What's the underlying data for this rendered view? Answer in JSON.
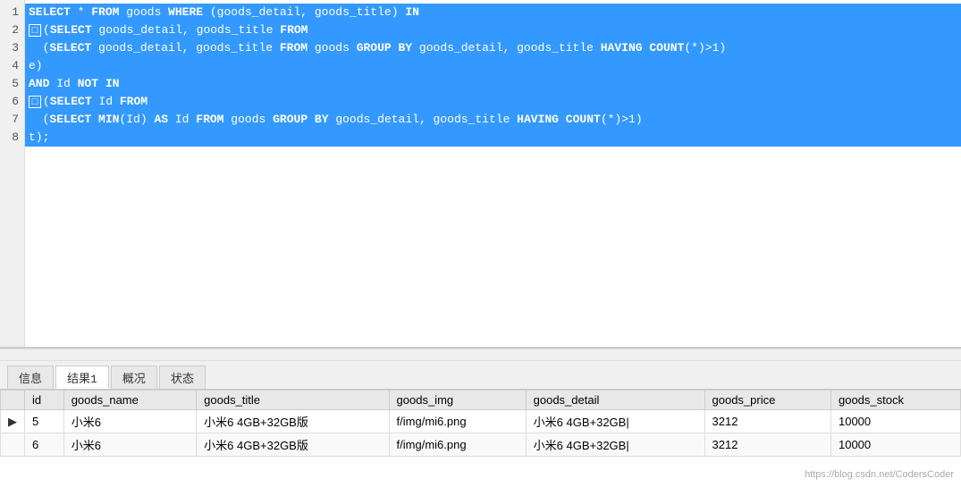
{
  "editor": {
    "lines": [
      {
        "num": 1,
        "selected": true,
        "has_collapse": false,
        "text": "SELECT *  FROM goods WHERE (goods_detail, goods_title) IN"
      },
      {
        "num": 2,
        "selected": true,
        "has_collapse": true,
        "text": "(SELECT goods_detail, goods_title FROM"
      },
      {
        "num": 3,
        "selected": true,
        "has_collapse": false,
        "text": "  (SELECT goods_detail, goods_title FROM goods GROUP BY goods_detail, goods_title HAVING COUNT(*)>1)"
      },
      {
        "num": 4,
        "selected": true,
        "has_collapse": false,
        "text": "e)"
      },
      {
        "num": 5,
        "selected": true,
        "has_collapse": false,
        "text": "AND Id NOT IN"
      },
      {
        "num": 6,
        "selected": true,
        "has_collapse": true,
        "text": "(SELECT Id FROM"
      },
      {
        "num": 7,
        "selected": true,
        "has_collapse": false,
        "text": "  (SELECT MIN(Id) AS Id FROM goods GROUP BY goods_detail, goods_title HAVING COUNT(*)>1)"
      },
      {
        "num": 8,
        "selected": true,
        "has_collapse": false,
        "text": "t);"
      }
    ]
  },
  "tabs": {
    "items": [
      {
        "label": "信息",
        "active": false
      },
      {
        "label": "结果1",
        "active": true
      },
      {
        "label": "概况",
        "active": false
      },
      {
        "label": "状态",
        "active": false
      }
    ]
  },
  "table": {
    "headers": [
      "id",
      "goods_name",
      "goods_title",
      "goods_img",
      "goods_detail",
      "goods_price",
      "goods_stock"
    ],
    "rows": [
      {
        "indicator": "▶",
        "values": [
          "5",
          "小米6",
          "小米6 4GB+32GB版",
          "f/img/mi6.png",
          "小米6 4GB+32GB|",
          "3212",
          "10000"
        ]
      },
      {
        "indicator": "",
        "values": [
          "6",
          "小米6",
          "小米6 4GB+32GB版",
          "f/img/mi6.png",
          "小米6 4GB+32GB|",
          "3212",
          "10000"
        ]
      }
    ]
  },
  "watermark": "https://blog.csdn.net/CodersCoder"
}
